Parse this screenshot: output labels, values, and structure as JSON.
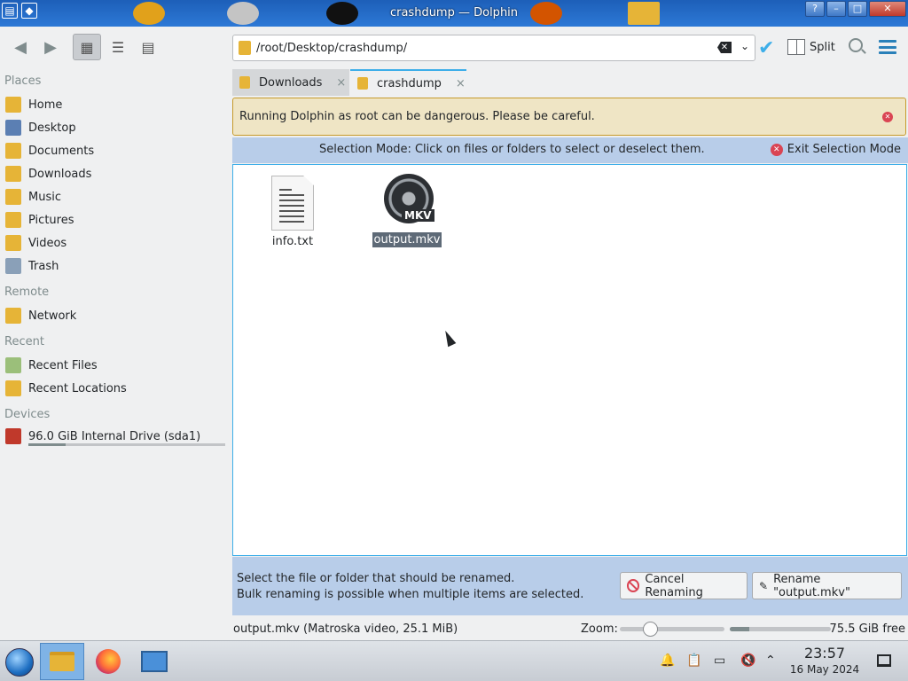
{
  "window": {
    "title": "crashdump — Dolphin"
  },
  "toolbar": {
    "path": "/root/Desktop/crashdump/",
    "split_label": "Split"
  },
  "sidebar": {
    "places_title": "Places",
    "places": [
      {
        "label": "Home",
        "icon": "home-folder-icon",
        "color": "#e6b437"
      },
      {
        "label": "Desktop",
        "icon": "desktop-icon",
        "color": "#5b7fb3"
      },
      {
        "label": "Documents",
        "icon": "documents-folder-icon",
        "color": "#e6b437"
      },
      {
        "label": "Downloads",
        "icon": "downloads-folder-icon",
        "color": "#e6b437"
      },
      {
        "label": "Music",
        "icon": "music-folder-icon",
        "color": "#e6b437"
      },
      {
        "label": "Pictures",
        "icon": "pictures-folder-icon",
        "color": "#e6b437"
      },
      {
        "label": "Videos",
        "icon": "videos-folder-icon",
        "color": "#e6b437"
      },
      {
        "label": "Trash",
        "icon": "trash-icon",
        "color": "#8aa0b8"
      }
    ],
    "remote_title": "Remote",
    "remote": [
      {
        "label": "Network",
        "icon": "network-folder-icon",
        "color": "#e6b437"
      }
    ],
    "recent_title": "Recent",
    "recent": [
      {
        "label": "Recent Files",
        "icon": "recent-files-icon",
        "color": "#9bbf7a"
      },
      {
        "label": "Recent Locations",
        "icon": "recent-locations-icon",
        "color": "#e6b437"
      }
    ],
    "devices_title": "Devices",
    "devices": [
      {
        "label": "96.0 GiB Internal Drive (sda1)",
        "icon": "hard-drive-icon",
        "color": "#c0392b",
        "usage_fraction": 0.19
      }
    ]
  },
  "tabs": [
    {
      "label": "Downloads",
      "close": "×",
      "active": false
    },
    {
      "label": "crashdump",
      "close": "×",
      "active": true
    }
  ],
  "warning": {
    "text": "Running Dolphin as root can be dangerous. Please be careful."
  },
  "selection_bar": {
    "message": "Selection Mode: Click on files or folders to select or deselect them.",
    "exit_label": "Exit Selection Mode"
  },
  "files": [
    {
      "name": "info.txt",
      "type": "text",
      "selected": false
    },
    {
      "name": "output.mkv",
      "type": "video",
      "badge": "MKV",
      "selected": true
    }
  ],
  "rename_bar": {
    "line1": "Select the file or folder that should be renamed.",
    "line2": "Bulk renaming is possible when multiple items are selected.",
    "cancel_label": "Cancel Renaming",
    "rename_label": "Rename \"output.mkv\""
  },
  "statusbar": {
    "info": "output.mkv (Matroska video, 25.1 MiB)",
    "zoom_label": "Zoom:",
    "zoom_fraction": 0.25,
    "free_space": "75.5 GiB free",
    "used_fraction": 0.19
  },
  "taskbar": {
    "time": "23:57",
    "date": "16 May 2024"
  }
}
